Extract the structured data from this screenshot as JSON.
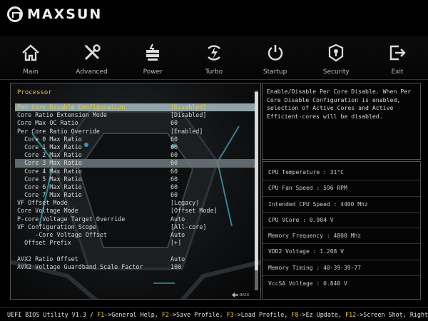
{
  "header": {
    "brand": "MAXSUN"
  },
  "nav": [
    {
      "label": "Main",
      "icon": "home-icon"
    },
    {
      "label": "Advanced",
      "icon": "tools-icon"
    },
    {
      "label": "Power",
      "icon": "power-supply-icon"
    },
    {
      "label": "Turbo",
      "icon": "turbo-icon"
    },
    {
      "label": "Startup",
      "icon": "power-icon"
    },
    {
      "label": "Security",
      "icon": "security-icon"
    },
    {
      "label": "Exit",
      "icon": "exit-icon"
    }
  ],
  "main": {
    "section_title": "Processor",
    "settings": [
      {
        "label": "Per Core Disable Configuration",
        "value": "[Disabled]"
      },
      {
        "label": "Core Ratio Extension Mode",
        "value": "[Disabled]"
      },
      {
        "label": "Core Max OC Ratio",
        "value": "60"
      },
      {
        "label": "Per Core Ratio Override",
        "value": "[Enabled]"
      },
      {
        "label": "  Core 0 Max Ratio",
        "value": "60"
      },
      {
        "label": "  Core 1 Max Ratio",
        "value": "60"
      },
      {
        "label": "  Core 2 Max Ratio",
        "value": "60"
      },
      {
        "label": "  Core 3 Max Ratio",
        "value": "60"
      },
      {
        "label": "  Core 4 Max Ratio",
        "value": "60"
      },
      {
        "label": "  Core 5 Max Ratio",
        "value": "60"
      },
      {
        "label": "  Core 6 Max Ratio",
        "value": "60"
      },
      {
        "label": "  Core 7 Max Ratio",
        "value": "60"
      },
      {
        "label": "VF Offset Mode",
        "value": "[Legacy]"
      },
      {
        "label": "Core Voltage Mode",
        "value": "[Offset Mode]"
      },
      {
        "label": "P-core Voltage Target Override",
        "value": "Auto"
      },
      {
        "label": "VF Configuration Scope",
        "value": "[All-core]"
      },
      {
        "label": "     -Core Voltage Offset",
        "value": "Auto"
      },
      {
        "label": "  Offset Prefix",
        "value": "[+]"
      },
      {
        "label": "",
        "value": ""
      },
      {
        "label": "AVX2 Ratio Offset",
        "value": "Auto"
      },
      {
        "label": "AVX2 Voltage Guardband Scale Factor",
        "value": "100"
      }
    ],
    "back_label": "BACK"
  },
  "help": {
    "lines": [
      "Enable/Disable Per Core Disable. When Per",
      "Core Disable Configuration is enabled,",
      "selection of Active Cores and Active",
      "Efficient-cores will be disabled."
    ]
  },
  "status": [
    "CPU Temperature : 31°C",
    "CPU Fan Speed : 596 RPM",
    "Intended CPU Speed : 4400 Mhz",
    "CPU VCore : 0.904 V",
    "Memory Frequency : 4800 Mhz",
    "VDD2 Voltage : 1.208 V",
    "Memory Timing : 40-39-39-77",
    "VccSA Voltage : 0.840 V"
  ],
  "footer": {
    "title": "UEFI BIOS Utility V1.3 / ",
    "hints": [
      {
        "key": "F1",
        "text": "->General Help, "
      },
      {
        "key": "F2",
        "text": "->Save Profile, "
      },
      {
        "key": "F3",
        "text": "->Load Profile, "
      },
      {
        "key": "F8",
        "text": "->Ez Update, "
      },
      {
        "key": "F12",
        "text": "->Screen Shot, Right"
      }
    ]
  },
  "colors": {
    "accent_yellow": "#e8c94a",
    "selected_row": "#8fa3a8",
    "cyan_glow": "#3fb6c4"
  }
}
